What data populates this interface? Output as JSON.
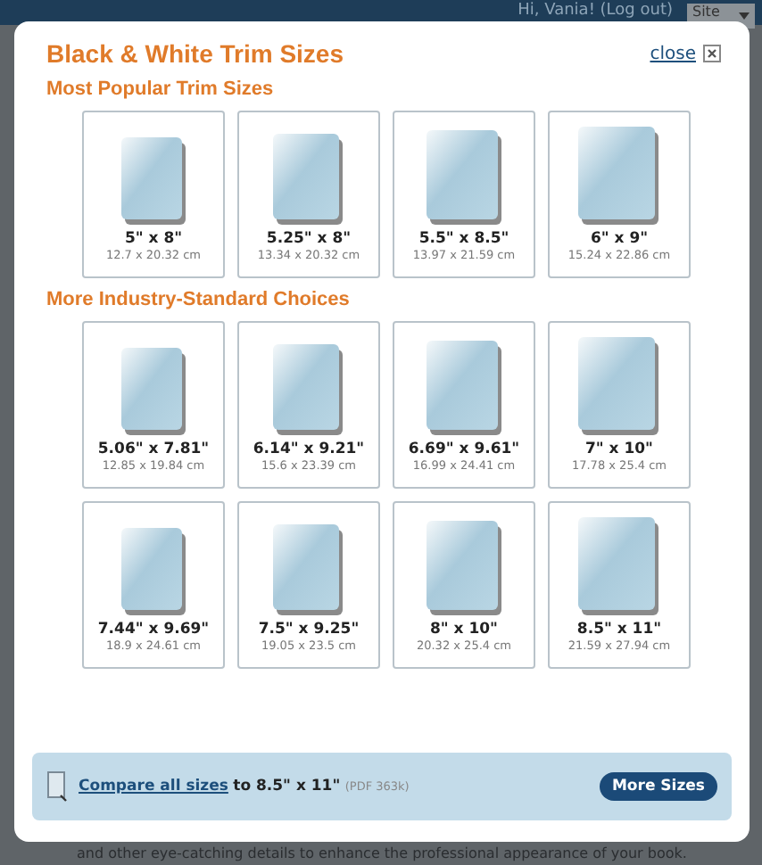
{
  "background": {
    "greeting": "Hi, Vania! (Log out)",
    "site_select": "Site",
    "footer_text": "and other eye-catching details to enhance the professional appearance of your book."
  },
  "dialog": {
    "title": "Black & White Trim Sizes",
    "close": "close",
    "sections": [
      {
        "heading": "Most Popular Trim Sizes",
        "sizes": [
          {
            "inches": "5\" x 8\"",
            "cm": "12.7 x 20.32 cm"
          },
          {
            "inches": "5.25\" x 8\"",
            "cm": "13.34 x 20.32 cm"
          },
          {
            "inches": "5.5\" x 8.5\"",
            "cm": "13.97 x 21.59 cm"
          },
          {
            "inches": "6\" x 9\"",
            "cm": "15.24 x 22.86 cm"
          }
        ]
      },
      {
        "heading": "More Industry-Standard Choices",
        "sizes": [
          {
            "inches": "5.06\" x 7.81\"",
            "cm": "12.85 x 19.84 cm"
          },
          {
            "inches": "6.14\" x 9.21\"",
            "cm": "15.6 x 23.39 cm"
          },
          {
            "inches": "6.69\" x 9.61\"",
            "cm": "16.99 x 24.41 cm"
          },
          {
            "inches": "7\" x 10\"",
            "cm": "17.78 x 25.4 cm"
          },
          {
            "inches": "7.44\" x 9.69\"",
            "cm": "18.9 x 24.61 cm"
          },
          {
            "inches": "7.5\" x 9.25\"",
            "cm": "19.05 x 23.5 cm"
          },
          {
            "inches": "8\" x 10\"",
            "cm": "20.32 x 25.4 cm"
          },
          {
            "inches": "8.5\" x 11\"",
            "cm": "21.59 x 27.94 cm"
          }
        ]
      }
    ],
    "footer": {
      "link": "Compare all sizes",
      "text": "to 8.5\" x 11\"",
      "note": "(PDF 363k)",
      "button": "More Sizes"
    }
  }
}
